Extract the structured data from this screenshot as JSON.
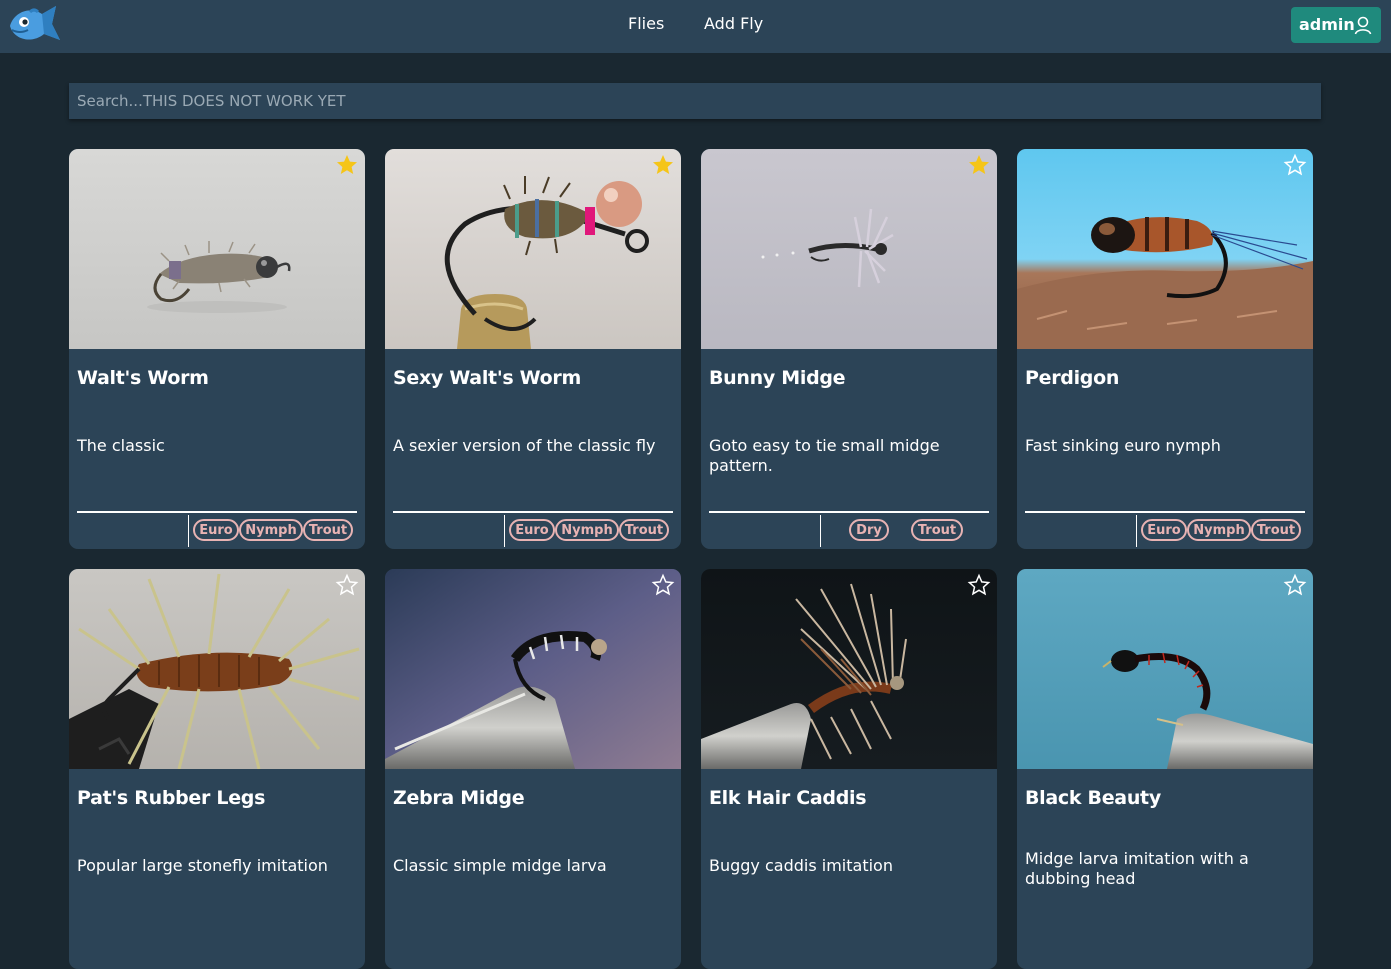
{
  "navbar": {
    "links": [
      "Flies",
      "Add Fly"
    ],
    "user_label": "admin"
  },
  "search": {
    "placeholder": "Search...THIS DOES NOT WORK YET",
    "value": ""
  },
  "icons": {
    "logo": "fish-logo-icon",
    "user": "user-icon",
    "favorite_on": "star-filled-icon",
    "favorite_off": "star-outline-icon"
  },
  "colors": {
    "background": "#1a2831",
    "navbar": "#2c4457",
    "card": "#2c4457",
    "accent": "#1f8a7d",
    "tag": "#e8b3b3",
    "star": "#f5c518"
  },
  "flies": [
    {
      "title": "Walt's Worm",
      "description": "The classic",
      "favorite": true,
      "tags": [
        "Euro",
        "Nymph",
        "Trout"
      ]
    },
    {
      "title": "Sexy Walt's Worm",
      "description": "A sexier version of the classic fly",
      "favorite": true,
      "tags": [
        "Euro",
        "Nymph",
        "Trout"
      ]
    },
    {
      "title": "Bunny Midge",
      "description": "Goto easy to tie small midge pattern.",
      "favorite": true,
      "tags": [
        "Dry",
        "Trout"
      ]
    },
    {
      "title": "Perdigon",
      "description": "Fast sinking euro nymph",
      "favorite": false,
      "tags": [
        "Euro",
        "Nymph",
        "Trout"
      ]
    },
    {
      "title": "Pat's Rubber Legs",
      "description": "Popular large stonefly imitation",
      "favorite": false,
      "tags": []
    },
    {
      "title": "Zebra Midge",
      "description": "Classic simple midge larva",
      "favorite": false,
      "tags": []
    },
    {
      "title": "Elk Hair Caddis",
      "description": "Buggy caddis imitation",
      "favorite": false,
      "tags": []
    },
    {
      "title": "Black Beauty",
      "description": "Midge larva imitation with a dubbing head",
      "favorite": false,
      "tags": []
    }
  ]
}
